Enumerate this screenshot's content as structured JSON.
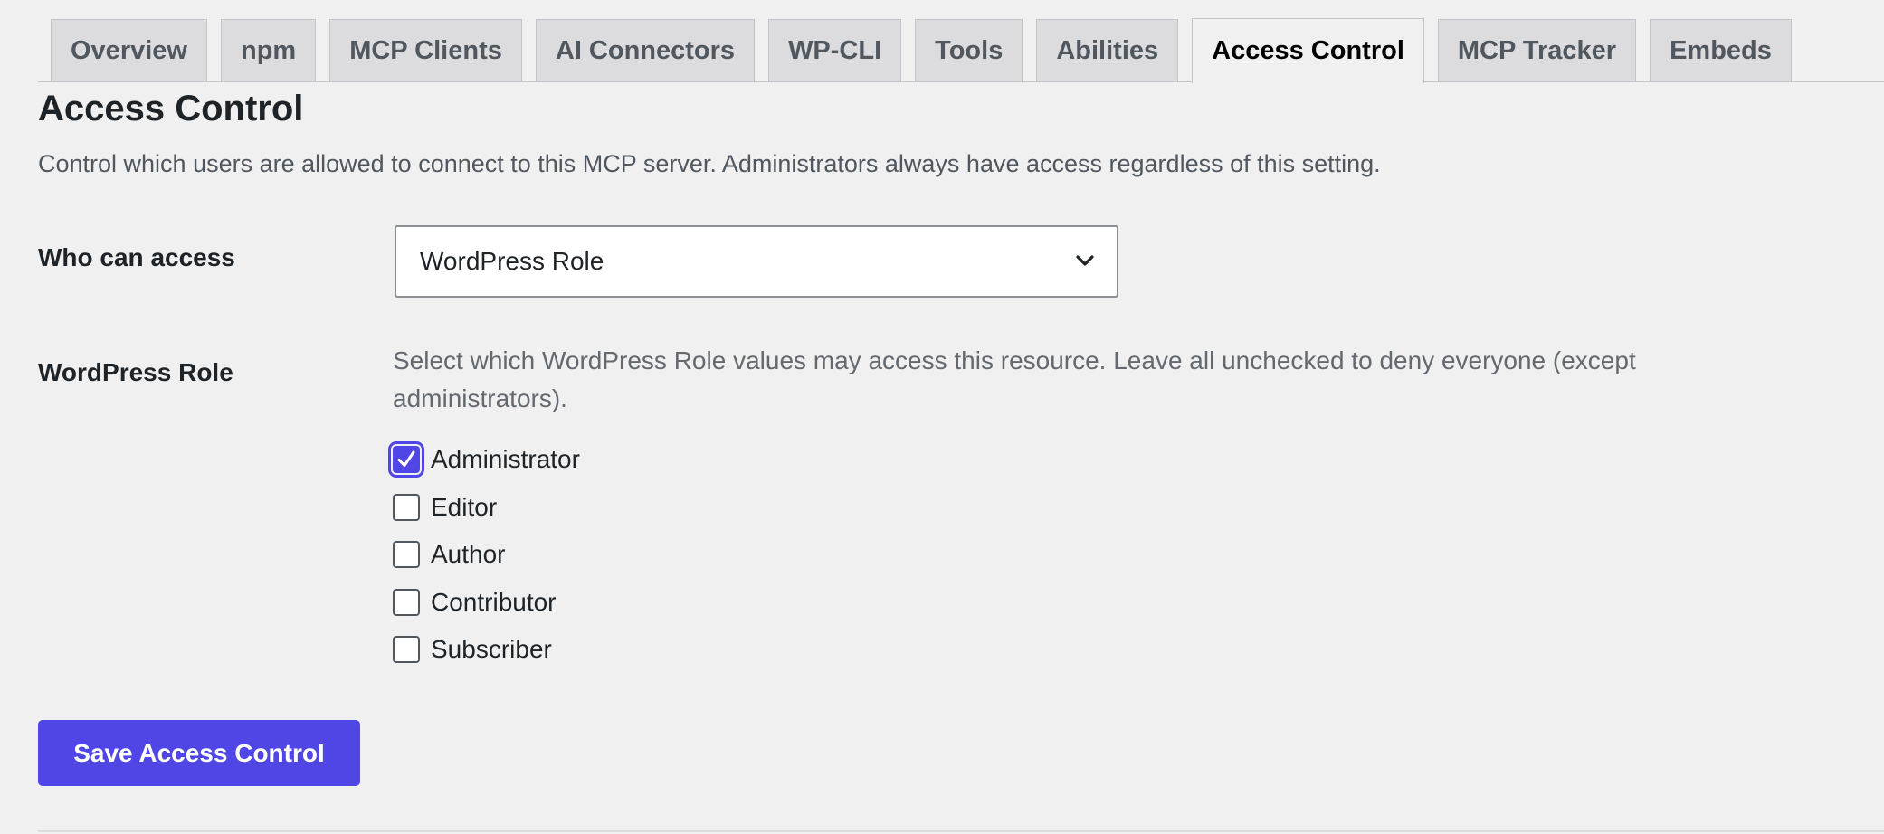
{
  "tabs": [
    {
      "label": "Overview",
      "active": false
    },
    {
      "label": "npm",
      "active": false
    },
    {
      "label": "MCP Clients",
      "active": false
    },
    {
      "label": "AI Connectors",
      "active": false
    },
    {
      "label": "WP-CLI",
      "active": false
    },
    {
      "label": "Tools",
      "active": false
    },
    {
      "label": "Abilities",
      "active": false
    },
    {
      "label": "Access Control",
      "active": true
    },
    {
      "label": "MCP Tracker",
      "active": false
    },
    {
      "label": "Embeds",
      "active": false
    }
  ],
  "page": {
    "title": "Access Control",
    "description": "Control which users are allowed to connect to this MCP server. Administrators always have access regardless of this setting."
  },
  "who_can_access": {
    "label": "Who can access",
    "selected": "WordPress Role"
  },
  "wordpress_role": {
    "label": "WordPress Role",
    "help": "Select which WordPress Role values may access this resource. Leave all unchecked to deny everyone (except administrators).",
    "roles": [
      {
        "label": "Administrator",
        "checked": true
      },
      {
        "label": "Editor",
        "checked": false
      },
      {
        "label": "Author",
        "checked": false
      },
      {
        "label": "Contributor",
        "checked": false
      },
      {
        "label": "Subscriber",
        "checked": false
      }
    ]
  },
  "save_button": {
    "label": "Save Access Control"
  },
  "colors": {
    "accent": "#4f46e5",
    "background": "#f0f0f1",
    "tab_inactive": "#dcdcde"
  },
  "icons": {
    "select_chevron": "chevron-down-icon",
    "checkbox_check": "checkmark-icon"
  }
}
